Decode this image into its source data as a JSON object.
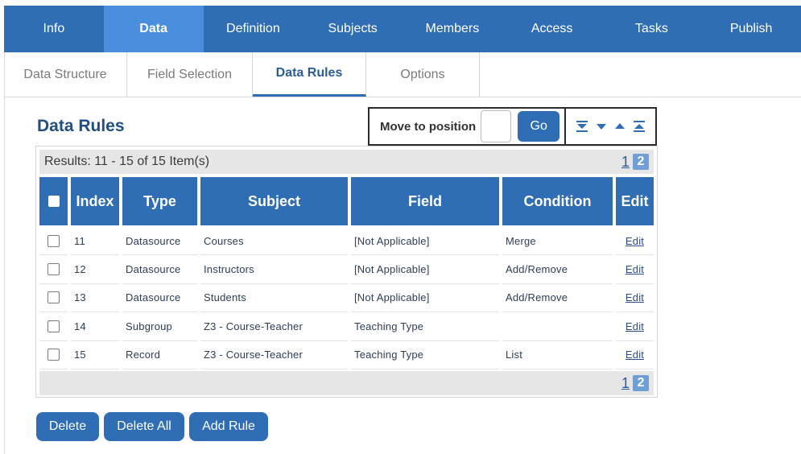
{
  "colors": {
    "nav_bg": "#2f6db5",
    "nav_active": "#4a8fde",
    "header_bg": "#2f6db5",
    "pager_active": "#6f9fd5"
  },
  "topnav": {
    "tabs": [
      {
        "label": "Info"
      },
      {
        "label": "Data",
        "active": true
      },
      {
        "label": "Definition"
      },
      {
        "label": "Subjects"
      },
      {
        "label": "Members"
      },
      {
        "label": "Access"
      },
      {
        "label": "Tasks"
      },
      {
        "label": "Publish"
      }
    ]
  },
  "subtabs": {
    "tabs": [
      {
        "label": "Data Structure"
      },
      {
        "label": "Field Selection"
      },
      {
        "label": "Data Rules",
        "active": true
      },
      {
        "label": "Options"
      }
    ]
  },
  "page": {
    "title": "Data Rules"
  },
  "move": {
    "label": "Move to position",
    "input_value": "",
    "go_label": "Go",
    "icons": [
      "move-to-bottom-icon",
      "move-down-icon",
      "move-up-icon",
      "move-to-top-icon"
    ]
  },
  "results": {
    "text": "Results: 11 - 15 of 15 Item(s)"
  },
  "pager": {
    "page1": "1",
    "page2": "2",
    "current": "2"
  },
  "table": {
    "columns": [
      "",
      "Index",
      "Type",
      "Subject",
      "Field",
      "Condition",
      "Edit"
    ],
    "rows": [
      {
        "index": "11",
        "type": "Datasource",
        "subject": "Courses",
        "field": "[Not Applicable]",
        "condition": "Merge",
        "edit": "Edit"
      },
      {
        "index": "12",
        "type": "Datasource",
        "subject": "Instructors",
        "field": "[Not Applicable]",
        "condition": "Add/Remove",
        "edit": "Edit"
      },
      {
        "index": "13",
        "type": "Datasource",
        "subject": "Students",
        "field": "[Not Applicable]",
        "condition": "Add/Remove",
        "edit": "Edit"
      },
      {
        "index": "14",
        "type": "Subgroup",
        "subject": "Z3 - Course-Teacher",
        "field": "Teaching Type",
        "condition": "",
        "edit": "Edit"
      },
      {
        "index": "15",
        "type": "Record",
        "subject": "Z3 - Course-Teacher",
        "field": "Teaching Type",
        "condition": "List",
        "edit": "Edit"
      }
    ]
  },
  "actions": {
    "delete": "Delete",
    "delete_all": "Delete All",
    "add_rule": "Add Rule"
  }
}
